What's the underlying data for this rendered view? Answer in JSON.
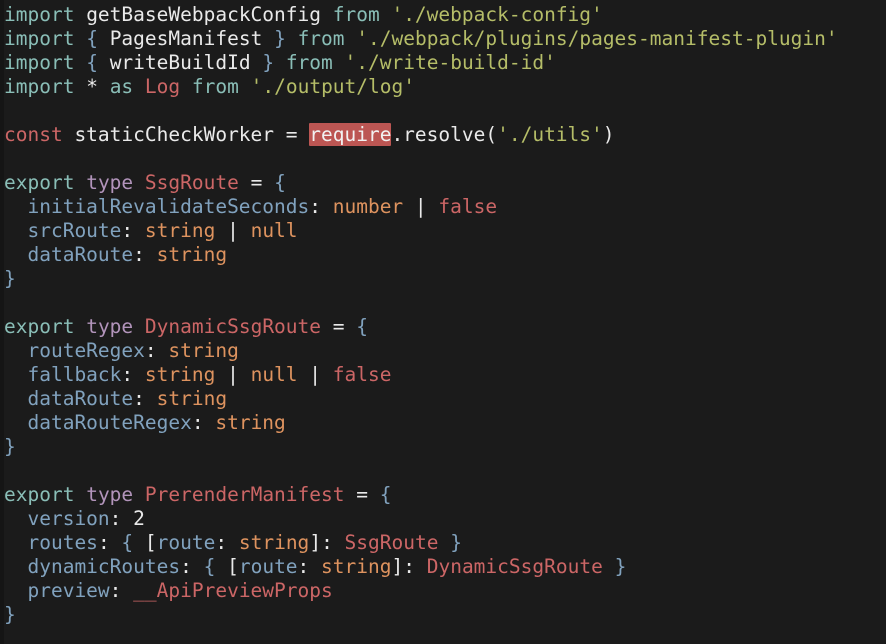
{
  "editor": {
    "background_color": "#1b1b1b",
    "gutter_color": "#151515",
    "highlight_color": "#bc5653",
    "palette": {
      "keyword": "#8abeb7",
      "type_keyword": "#b294bb",
      "red": "#cc6666",
      "string": "#b5bd68",
      "property": "#81a2be",
      "builtin": "#de935f",
      "plain": "#eaeaea"
    }
  },
  "lines": [
    {
      "id": "line-1",
      "tokens": [
        {
          "t": "import",
          "c": "keyword"
        },
        {
          "t": " getBaseWebpackConfig ",
          "c": "plain"
        },
        {
          "t": "from",
          "c": "keyword"
        },
        {
          "t": " ",
          "c": "plain"
        },
        {
          "t": "'./webpack-config'",
          "c": "string"
        }
      ]
    },
    {
      "id": "line-2",
      "tokens": [
        {
          "t": "import",
          "c": "keyword"
        },
        {
          "t": " ",
          "c": "plain"
        },
        {
          "t": "{",
          "c": "property"
        },
        {
          "t": " PagesManifest ",
          "c": "plain"
        },
        {
          "t": "}",
          "c": "property"
        },
        {
          "t": " ",
          "c": "plain"
        },
        {
          "t": "from",
          "c": "keyword"
        },
        {
          "t": " ",
          "c": "plain"
        },
        {
          "t": "'./webpack/plugins/pages-manifest-plugin'",
          "c": "string"
        }
      ]
    },
    {
      "id": "line-3",
      "tokens": [
        {
          "t": "import",
          "c": "keyword"
        },
        {
          "t": " ",
          "c": "plain"
        },
        {
          "t": "{",
          "c": "property"
        },
        {
          "t": " writeBuildId ",
          "c": "plain"
        },
        {
          "t": "}",
          "c": "property"
        },
        {
          "t": " ",
          "c": "plain"
        },
        {
          "t": "from",
          "c": "keyword"
        },
        {
          "t": " ",
          "c": "plain"
        },
        {
          "t": "'./write-build-id'",
          "c": "string"
        }
      ]
    },
    {
      "id": "line-4",
      "tokens": [
        {
          "t": "import",
          "c": "keyword"
        },
        {
          "t": " * ",
          "c": "plain"
        },
        {
          "t": "as",
          "c": "keyword"
        },
        {
          "t": " ",
          "c": "plain"
        },
        {
          "t": "Log",
          "c": "red"
        },
        {
          "t": " ",
          "c": "plain"
        },
        {
          "t": "from",
          "c": "keyword"
        },
        {
          "t": " ",
          "c": "plain"
        },
        {
          "t": "'./output/log'",
          "c": "string"
        }
      ]
    },
    {
      "id": "line-5",
      "tokens": []
    },
    {
      "id": "line-6",
      "tokens": [
        {
          "t": "const",
          "c": "red"
        },
        {
          "t": " staticCheckWorker = ",
          "c": "plain"
        },
        {
          "t": "require",
          "c": "highlight"
        },
        {
          "t": ".resolve(",
          "c": "plain"
        },
        {
          "t": "'./utils'",
          "c": "string"
        },
        {
          "t": ")",
          "c": "plain"
        }
      ]
    },
    {
      "id": "line-7",
      "tokens": []
    },
    {
      "id": "line-8",
      "tokens": [
        {
          "t": "export",
          "c": "keyword"
        },
        {
          "t": " ",
          "c": "plain"
        },
        {
          "t": "type",
          "c": "type_keyword"
        },
        {
          "t": " ",
          "c": "plain"
        },
        {
          "t": "SsgRoute",
          "c": "red"
        },
        {
          "t": " = ",
          "c": "plain"
        },
        {
          "t": "{",
          "c": "property"
        }
      ]
    },
    {
      "id": "line-9",
      "tokens": [
        {
          "t": "  ",
          "c": "plain"
        },
        {
          "t": "initialRevalidateSeconds",
          "c": "property"
        },
        {
          "t": ": ",
          "c": "plain"
        },
        {
          "t": "number",
          "c": "builtin"
        },
        {
          "t": " | ",
          "c": "plain"
        },
        {
          "t": "false",
          "c": "red"
        }
      ]
    },
    {
      "id": "line-10",
      "tokens": [
        {
          "t": "  ",
          "c": "plain"
        },
        {
          "t": "srcRoute",
          "c": "property"
        },
        {
          "t": ": ",
          "c": "plain"
        },
        {
          "t": "string",
          "c": "builtin"
        },
        {
          "t": " | ",
          "c": "plain"
        },
        {
          "t": "null",
          "c": "builtin"
        }
      ]
    },
    {
      "id": "line-11",
      "tokens": [
        {
          "t": "  ",
          "c": "plain"
        },
        {
          "t": "dataRoute",
          "c": "property"
        },
        {
          "t": ": ",
          "c": "plain"
        },
        {
          "t": "string",
          "c": "builtin"
        }
      ]
    },
    {
      "id": "line-12",
      "tokens": [
        {
          "t": "}",
          "c": "property"
        }
      ]
    },
    {
      "id": "line-13",
      "tokens": []
    },
    {
      "id": "line-14",
      "tokens": [
        {
          "t": "export",
          "c": "keyword"
        },
        {
          "t": " ",
          "c": "plain"
        },
        {
          "t": "type",
          "c": "type_keyword"
        },
        {
          "t": " ",
          "c": "plain"
        },
        {
          "t": "DynamicSsgRoute",
          "c": "red"
        },
        {
          "t": " = ",
          "c": "plain"
        },
        {
          "t": "{",
          "c": "property"
        }
      ]
    },
    {
      "id": "line-15",
      "tokens": [
        {
          "t": "  ",
          "c": "plain"
        },
        {
          "t": "routeRegex",
          "c": "property"
        },
        {
          "t": ": ",
          "c": "plain"
        },
        {
          "t": "string",
          "c": "builtin"
        }
      ]
    },
    {
      "id": "line-16",
      "tokens": [
        {
          "t": "  ",
          "c": "plain"
        },
        {
          "t": "fallback",
          "c": "property"
        },
        {
          "t": ": ",
          "c": "plain"
        },
        {
          "t": "string",
          "c": "builtin"
        },
        {
          "t": " | ",
          "c": "plain"
        },
        {
          "t": "null",
          "c": "builtin"
        },
        {
          "t": " | ",
          "c": "plain"
        },
        {
          "t": "false",
          "c": "red"
        }
      ]
    },
    {
      "id": "line-17",
      "tokens": [
        {
          "t": "  ",
          "c": "plain"
        },
        {
          "t": "dataRoute",
          "c": "property"
        },
        {
          "t": ": ",
          "c": "plain"
        },
        {
          "t": "string",
          "c": "builtin"
        }
      ]
    },
    {
      "id": "line-18",
      "tokens": [
        {
          "t": "  ",
          "c": "plain"
        },
        {
          "t": "dataRouteRegex",
          "c": "property"
        },
        {
          "t": ": ",
          "c": "plain"
        },
        {
          "t": "string",
          "c": "builtin"
        }
      ]
    },
    {
      "id": "line-19",
      "tokens": [
        {
          "t": "}",
          "c": "property"
        }
      ]
    },
    {
      "id": "line-20",
      "tokens": []
    },
    {
      "id": "line-21",
      "tokens": [
        {
          "t": "export",
          "c": "keyword"
        },
        {
          "t": " ",
          "c": "plain"
        },
        {
          "t": "type",
          "c": "type_keyword"
        },
        {
          "t": " ",
          "c": "plain"
        },
        {
          "t": "PrerenderManifest",
          "c": "red"
        },
        {
          "t": " = ",
          "c": "plain"
        },
        {
          "t": "{",
          "c": "property"
        }
      ]
    },
    {
      "id": "line-22",
      "tokens": [
        {
          "t": "  ",
          "c": "plain"
        },
        {
          "t": "version",
          "c": "property"
        },
        {
          "t": ": ",
          "c": "plain"
        },
        {
          "t": "2",
          "c": "plain"
        }
      ]
    },
    {
      "id": "line-23",
      "tokens": [
        {
          "t": "  ",
          "c": "plain"
        },
        {
          "t": "routes",
          "c": "property"
        },
        {
          "t": ": ",
          "c": "plain"
        },
        {
          "t": "{",
          "c": "property"
        },
        {
          "t": " ",
          "c": "plain"
        },
        {
          "t": "[",
          "c": "plain"
        },
        {
          "t": "route",
          "c": "property"
        },
        {
          "t": ": ",
          "c": "plain"
        },
        {
          "t": "string",
          "c": "builtin"
        },
        {
          "t": "]",
          "c": "plain"
        },
        {
          "t": ": ",
          "c": "plain"
        },
        {
          "t": "SsgRoute",
          "c": "red"
        },
        {
          "t": " ",
          "c": "plain"
        },
        {
          "t": "}",
          "c": "property"
        }
      ]
    },
    {
      "id": "line-24",
      "tokens": [
        {
          "t": "  ",
          "c": "plain"
        },
        {
          "t": "dynamicRoutes",
          "c": "property"
        },
        {
          "t": ": ",
          "c": "plain"
        },
        {
          "t": "{",
          "c": "property"
        },
        {
          "t": " ",
          "c": "plain"
        },
        {
          "t": "[",
          "c": "plain"
        },
        {
          "t": "route",
          "c": "property"
        },
        {
          "t": ": ",
          "c": "plain"
        },
        {
          "t": "string",
          "c": "builtin"
        },
        {
          "t": "]",
          "c": "plain"
        },
        {
          "t": ": ",
          "c": "plain"
        },
        {
          "t": "DynamicSsgRoute",
          "c": "red"
        },
        {
          "t": " ",
          "c": "plain"
        },
        {
          "t": "}",
          "c": "property"
        }
      ]
    },
    {
      "id": "line-25",
      "tokens": [
        {
          "t": "  ",
          "c": "plain"
        },
        {
          "t": "preview",
          "c": "property"
        },
        {
          "t": ": ",
          "c": "plain"
        },
        {
          "t": "__ApiPreviewProps",
          "c": "red"
        }
      ]
    },
    {
      "id": "line-26",
      "tokens": [
        {
          "t": "}",
          "c": "property"
        }
      ]
    }
  ]
}
